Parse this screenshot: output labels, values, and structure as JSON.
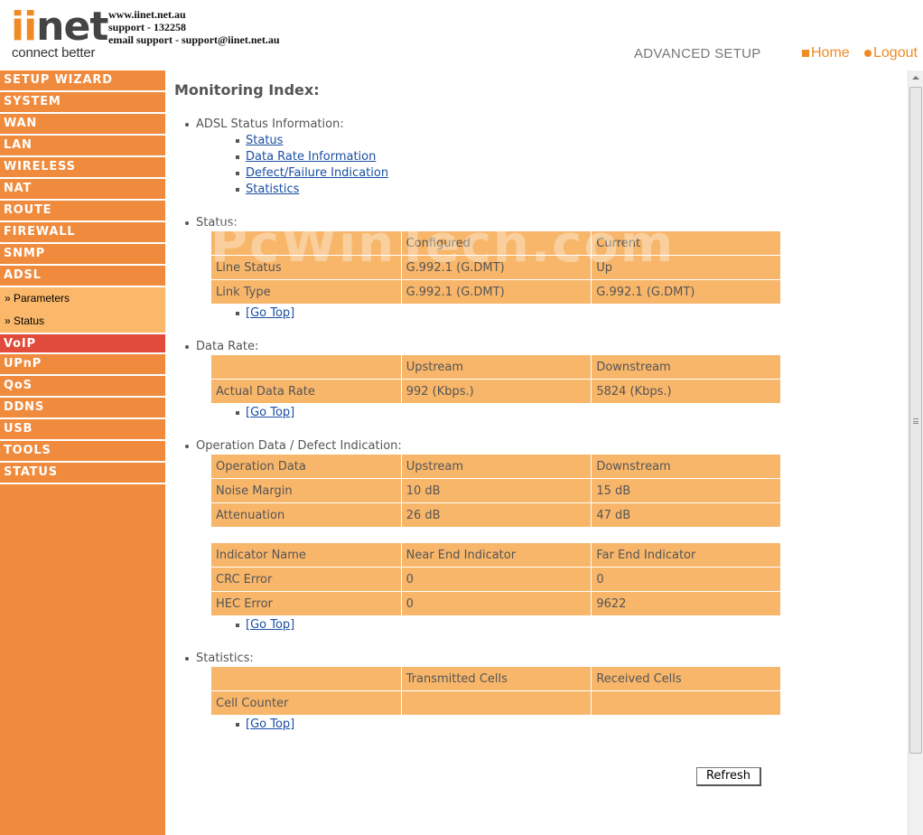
{
  "header": {
    "logo_word_accent": "ii",
    "logo_word_rest": "net",
    "logo_tagline": "connect better",
    "support_lines": [
      "www.iinet.net.au",
      "support - 132258",
      "email support - support@iinet.net.au"
    ],
    "section_title": "ADVANCED SETUP",
    "home_label": "Home",
    "logout_label": "Logout"
  },
  "sidebar": {
    "items": [
      "SETUP WIZARD",
      "SYSTEM",
      "WAN",
      "LAN",
      "WIRELESS",
      "NAT",
      "ROUTE",
      "FIREWALL",
      "SNMP",
      "ADSL"
    ],
    "adsl_subitems": [
      "» Parameters",
      "» Status"
    ],
    "items_after": [
      "VoIP",
      "UPnP",
      "QoS",
      "DDNS",
      "USB",
      "TOOLS",
      "STATUS"
    ]
  },
  "main": {
    "title": "Monitoring Index:",
    "index_heading": "ADSL Status Information:",
    "index_links": [
      "Status",
      "Data Rate Information",
      "Defect/Failure Indication",
      "Statistics"
    ],
    "go_top": "[Go Top]",
    "status": {
      "heading": "Status:",
      "header": [
        "",
        "Configured",
        "Current"
      ],
      "rows": [
        [
          "Line Status",
          "G.992.1 (G.DMT)",
          "Up"
        ],
        [
          "Link Type",
          "G.992.1 (G.DMT)",
          "G.992.1 (G.DMT)"
        ]
      ]
    },
    "data_rate": {
      "heading": "Data Rate:",
      "header": [
        "",
        "Upstream",
        "Downstream"
      ],
      "rows": [
        [
          "Actual Data Rate",
          "992 (Kbps.)",
          "5824 (Kbps.)"
        ]
      ]
    },
    "operation": {
      "heading": "Operation Data / Defect Indication:",
      "header": [
        "Operation Data",
        "Upstream",
        "Downstream"
      ],
      "rows": [
        [
          "Noise Margin",
          "10 dB",
          "15 dB"
        ],
        [
          "Attenuation",
          "26 dB",
          "47 dB"
        ]
      ],
      "indicator_header": [
        "Indicator Name",
        "Near End Indicator",
        "Far End Indicator"
      ],
      "indicator_rows": [
        [
          "CRC Error",
          "0",
          "0"
        ],
        [
          "HEC Error",
          "0",
          "9622"
        ]
      ]
    },
    "statistics": {
      "heading": "Statistics:",
      "header": [
        "",
        "Transmitted Cells",
        "Received Cells"
      ],
      "rows": [
        [
          "Cell Counter",
          "",
          ""
        ]
      ]
    },
    "refresh_label": "Refresh",
    "watermark": "PcWinTech.com"
  }
}
